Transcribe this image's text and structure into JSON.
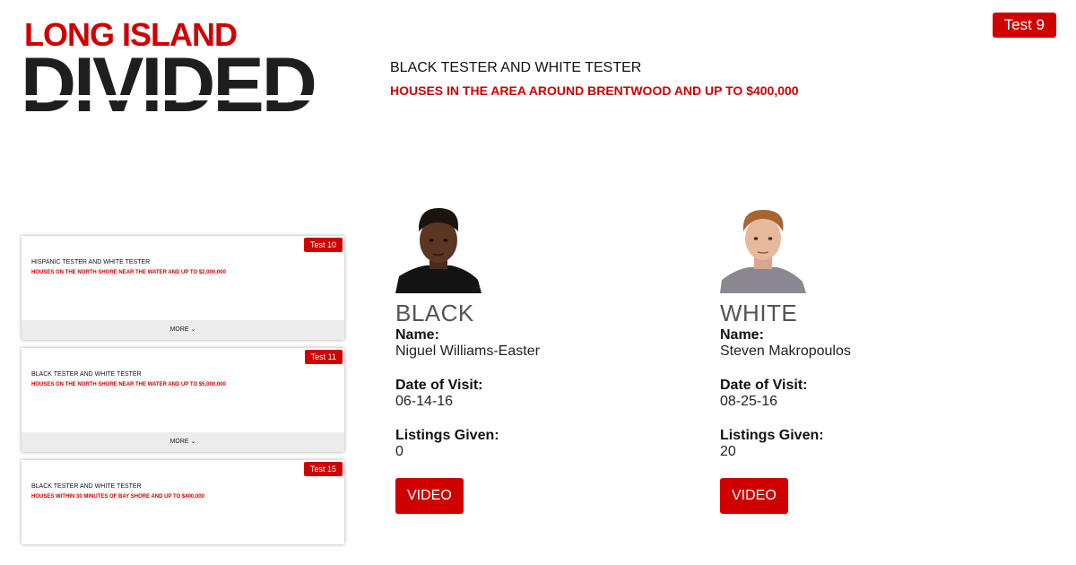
{
  "logo": {
    "line1": "LONG ISLAND",
    "line2": "DIVIDED"
  },
  "badge": "Test 9",
  "header": {
    "title": "BLACK TESTER AND WHITE TESTER",
    "subtitle": "HOUSES IN THE AREA AROUND BRENTWOOD AND UP TO $400,000"
  },
  "cards": [
    {
      "badge": "Test 10",
      "title": "HISPANIC TESTER AND WHITE TESTER",
      "subtitle": "HOUSES ON THE NORTH SHORE NEAR THE WATER AND UP TO $2,000,000",
      "more": "MORE ⌄"
    },
    {
      "badge": "Test 11",
      "title": "BLACK TESTER AND WHITE TESTER",
      "subtitle": "HOUSES ON THE NORTH SHORE NEAR THE WATER AND UP TO $5,000,000",
      "more": "MORE ⌄"
    },
    {
      "badge": "Test 15",
      "title": "BLACK TESTER AND WHITE TESTER",
      "subtitle": "HOUSES WITHIN 30 MINUTES OF BAY SHORE AND UP TO $400,000"
    }
  ],
  "labels": {
    "name": "Name:",
    "date": "Date of Visit:",
    "listings": "Listings Given:",
    "video": "VIDEO"
  },
  "testers": [
    {
      "race": "BLACK",
      "name": "Niguel Williams-Easter",
      "date": "06-14-16",
      "listings": "0"
    },
    {
      "race": "WHITE",
      "name": "Steven Makropoulos",
      "date": "08-25-16",
      "listings": "20"
    }
  ],
  "colors": {
    "accent": "#d00000",
    "logo_dark": "#1e1e1e"
  }
}
